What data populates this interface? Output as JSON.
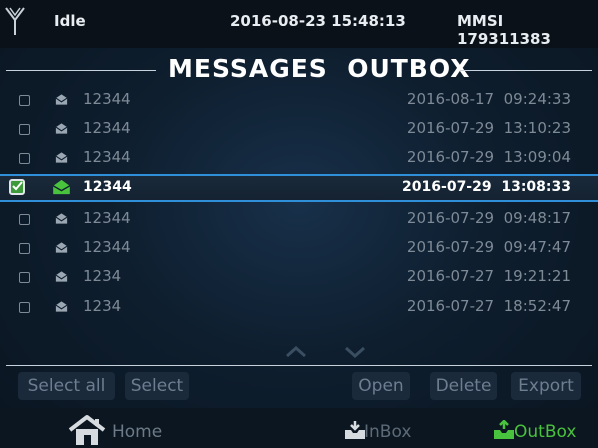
{
  "status_bar": {
    "status": "Idle",
    "datetime": "2016-08-23 15:48:13",
    "mmsi": "MMSI 179311383",
    "icon": "antenna-icon"
  },
  "title": "MESSAGES  OUTBOX",
  "messages": [
    {
      "recipient": "12344",
      "timestamp": "2016-08-17  09:24:33",
      "selected": false
    },
    {
      "recipient": "12344",
      "timestamp": "2016-07-29  13:10:23",
      "selected": false
    },
    {
      "recipient": "12344",
      "timestamp": "2016-07-29  13:09:04",
      "selected": false
    },
    {
      "recipient": "12344",
      "timestamp": "2016-07-29  13:08:33",
      "selected": true
    },
    {
      "recipient": "12344",
      "timestamp": "2016-07-29  09:48:17",
      "selected": false
    },
    {
      "recipient": "12344",
      "timestamp": "2016-07-29  09:47:47",
      "selected": false
    },
    {
      "recipient": "1234",
      "timestamp": "2016-07-27  19:21:21",
      "selected": false
    },
    {
      "recipient": "1234",
      "timestamp": "2016-07-27  18:52:47",
      "selected": false
    }
  ],
  "actions": {
    "select_all": "Select all",
    "select": "Select",
    "open": "Open",
    "delete": "Delete",
    "export": "Export"
  },
  "nav": {
    "home": "Home",
    "inbox": "InBox",
    "outbox": "OutBox",
    "active": "outbox"
  },
  "colors": {
    "accent_blue": "#2f8fd8",
    "active_green": "#49c23d",
    "background": "#0e1e2e"
  }
}
